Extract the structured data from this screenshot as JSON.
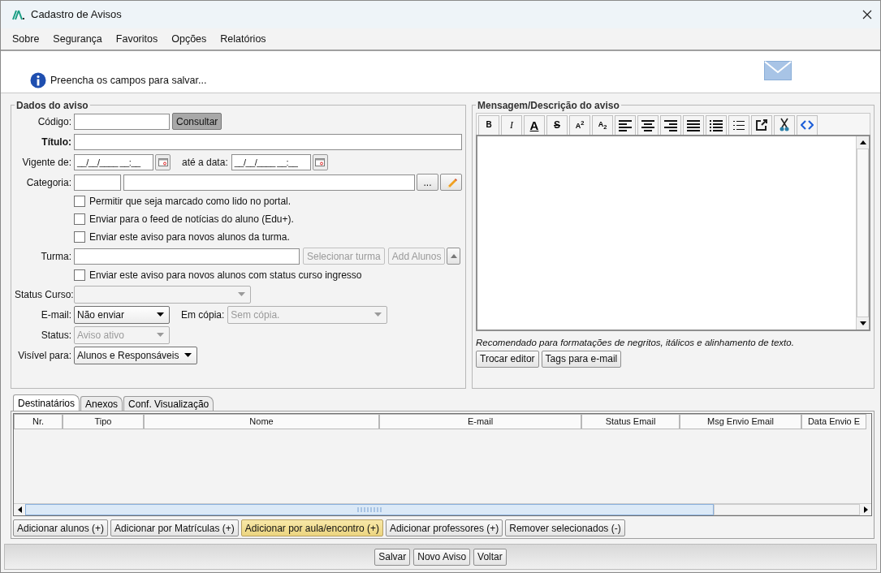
{
  "window": {
    "title": "Cadastro de Avisos"
  },
  "menu": [
    {
      "label": "Sobre"
    },
    {
      "label": "Segurança"
    },
    {
      "label": "Favoritos"
    },
    {
      "label": "Opções"
    },
    {
      "label": "Relatórios"
    }
  ],
  "info": {
    "message": "Preencha os campos para salvar..."
  },
  "dados_do_aviso": {
    "legend": "Dados do aviso",
    "codigo": {
      "label": "Código:",
      "button": "Consultar"
    },
    "titulo": {
      "label": "Título:"
    },
    "vigente_de": {
      "label": "Vigente de:",
      "value": "__/__/____ __:__"
    },
    "ate_a_data": {
      "label": "até a data:",
      "value": "__/__/____ __:__"
    },
    "categoria": {
      "label": "Categoria:",
      "browse_button": "..."
    },
    "options_top": [
      {
        "label": "Permitir que seja marcado como lido no portal.",
        "checked": false
      },
      {
        "label": "Enviar para o feed de notícias do aluno (Edu+).",
        "checked": false
      },
      {
        "label": "Enviar este aviso para novos alunos da turma.",
        "checked": false
      }
    ],
    "turma": {
      "label": "Turma:",
      "buttons": [
        {
          "label": "Selecionar turma",
          "disabled": true
        },
        {
          "label": "Add Alunos",
          "disabled": true
        }
      ]
    },
    "options_bottom": [
      {
        "label": "Enviar este aviso para novos alunos com status curso ingresso",
        "checked": false
      }
    ],
    "status_curso": {
      "label": "Status Curso:",
      "disabled": true
    },
    "email": {
      "label": "E-mail:",
      "value": "Não enviar",
      "disabled": false
    },
    "em_copia": {
      "label": "Em cópia:",
      "value": "Sem cópia.",
      "disabled": true
    },
    "status": {
      "label": "Status:",
      "value": "Aviso ativo",
      "disabled": true
    },
    "visivel_para": {
      "label": "Visível para:",
      "value": "Alunos e Responsáveis",
      "disabled": false
    }
  },
  "mensagem": {
    "legend": "Mensagem/Descrição do aviso",
    "toolbar": [
      {
        "kind": "bold",
        "glyph": "B"
      },
      {
        "kind": "italic",
        "glyph": "I"
      },
      {
        "kind": "font-color",
        "glyph": "A"
      },
      {
        "kind": "strike",
        "glyph": "S"
      },
      {
        "kind": "superscript",
        "glyph": "A$^{2}$"
      },
      {
        "kind": "subscript",
        "glyph": "A$_{2}$"
      },
      {
        "kind": "align-left"
      },
      {
        "kind": "align-center"
      },
      {
        "kind": "align-right"
      },
      {
        "kind": "justify"
      },
      {
        "kind": "bullet-list"
      },
      {
        "kind": "numbered-list"
      },
      {
        "kind": "external-link"
      },
      {
        "kind": "cut"
      },
      {
        "kind": "source"
      }
    ],
    "hint": "Recomendado para formatações de negritos, itálicos e alinhamento de texto.",
    "buttons": [
      {
        "label": "Trocar editor"
      },
      {
        "label": "Tags para e-mail"
      }
    ]
  },
  "tabs": [
    {
      "label": "Destinatários",
      "selected": true
    },
    {
      "label": "Anexos",
      "selected": false
    },
    {
      "label": "Conf. Visualização",
      "selected": false
    }
  ],
  "table": {
    "columns": [
      "Nr.",
      "Tipo",
      "Nome",
      "E-mail",
      "Status Email",
      "Msg Envio Email",
      "Data Envio E"
    ]
  },
  "table_buttons": [
    {
      "label": "Adicionar alunos (+)",
      "highlighted": false
    },
    {
      "label": "Adicionar por Matrículas (+)",
      "highlighted": false
    },
    {
      "label": "Adicionar por aula/encontro (+)",
      "highlighted": true
    },
    {
      "label": "Adicionar professores (+)",
      "highlighted": false
    },
    {
      "label": "Remover selecionados (-)",
      "highlighted": false
    }
  ],
  "footer_buttons": [
    {
      "label": "Salvar"
    },
    {
      "label": "Novo Aviso"
    },
    {
      "label": "Voltar"
    }
  ]
}
